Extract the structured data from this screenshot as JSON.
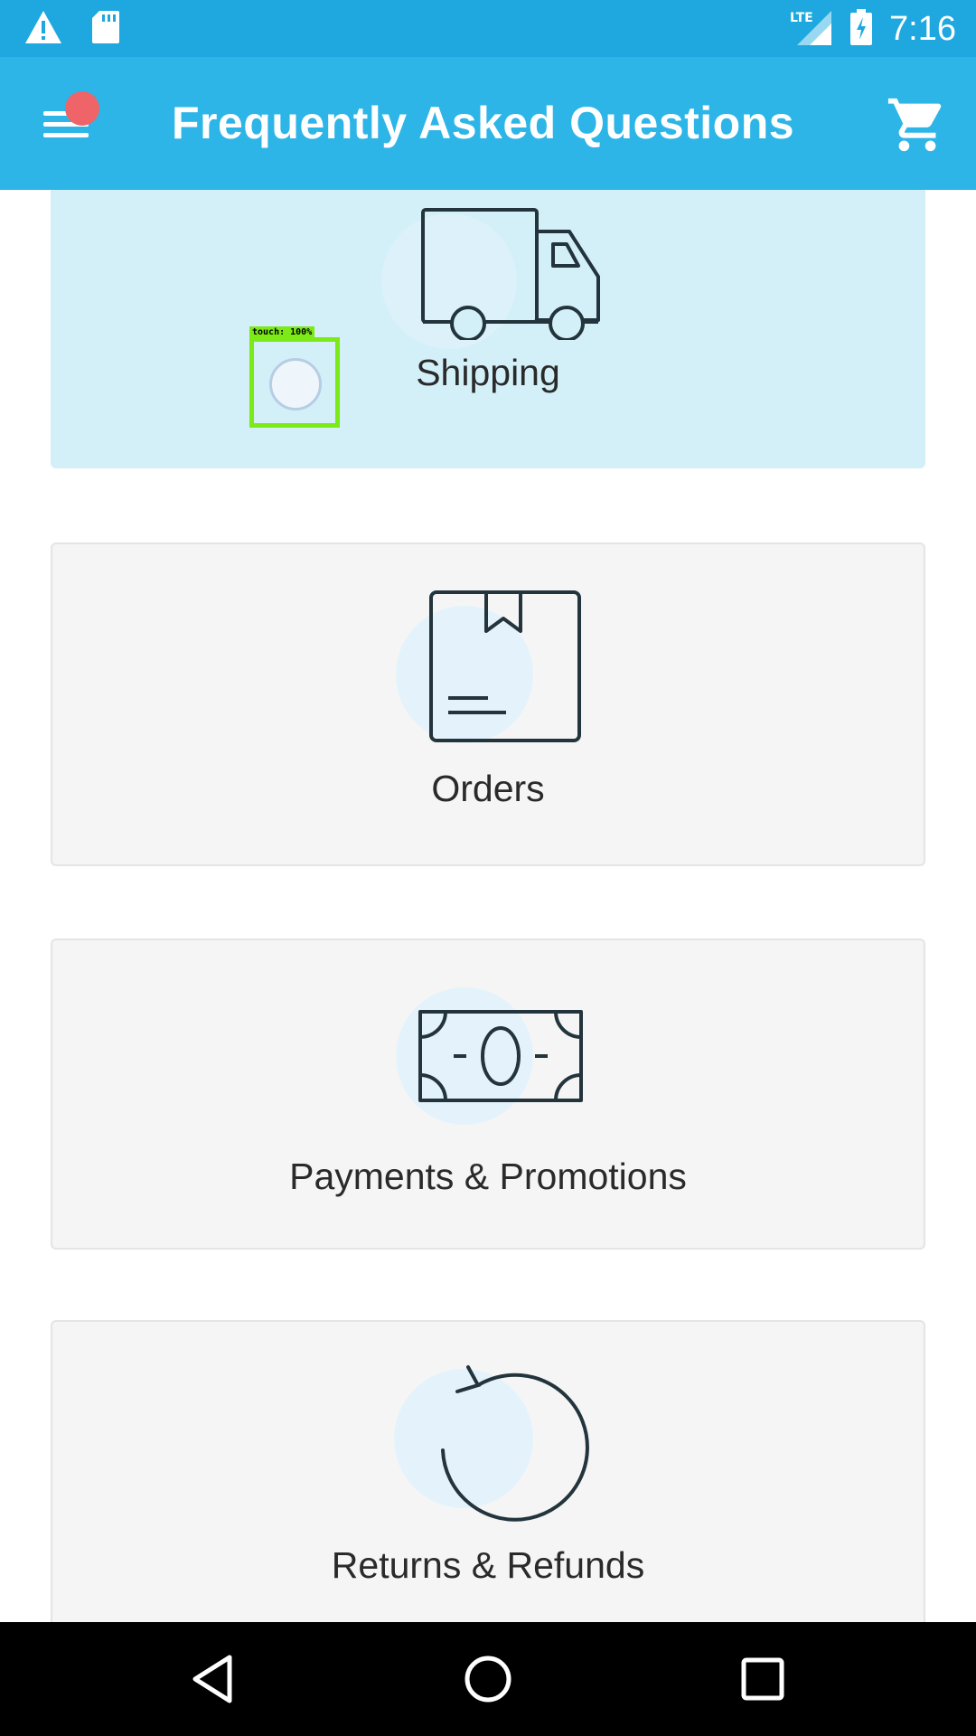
{
  "status_bar": {
    "time": "7:16",
    "icons": [
      "warning-icon",
      "sd-card-icon",
      "lte-signal-icon",
      "battery-charging-icon"
    ],
    "network": "LTE"
  },
  "app_bar": {
    "title": "Frequently Asked Questions",
    "menu_icon": "hamburger-menu-icon",
    "cart_icon": "shopping-cart-icon",
    "background": "#2db5e8"
  },
  "categories": [
    {
      "label": "Shipping",
      "icon": "truck-icon",
      "selected": true
    },
    {
      "label": "Orders",
      "icon": "package-box-icon",
      "selected": false
    },
    {
      "label": "Payments & Promotions",
      "icon": "banknote-icon",
      "selected": false
    },
    {
      "label": "Returns & Refunds",
      "icon": "refresh-arrow-icon",
      "selected": false
    }
  ],
  "touch_overlay": {
    "label": "touch: 100%"
  },
  "nav_bar": {
    "icons": [
      "back-icon",
      "home-icon",
      "recents-icon"
    ]
  }
}
